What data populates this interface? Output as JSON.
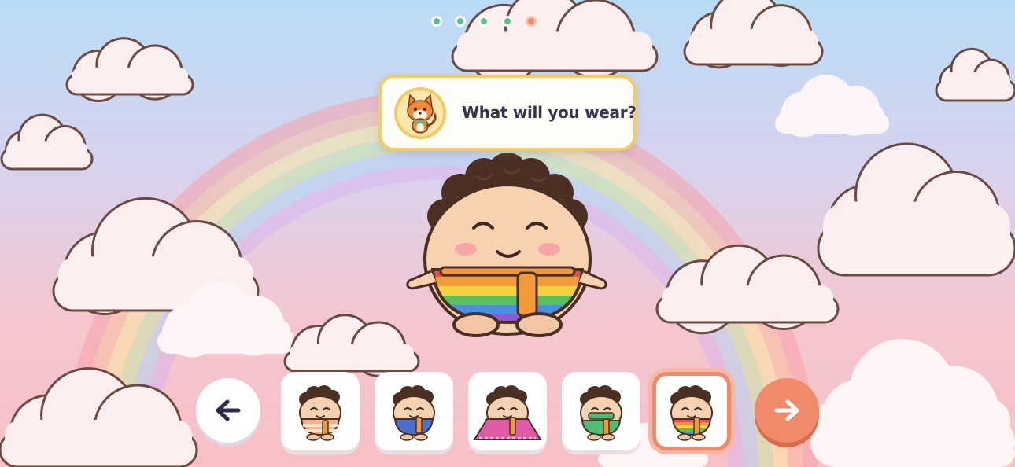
{
  "prompt": {
    "text": "What will you wear?",
    "guide_icon": "fox-guide-icon"
  },
  "progress": {
    "total_steps": 5,
    "current_step": 5,
    "colors": {
      "done": "#56c288",
      "current": "#f08a6a"
    }
  },
  "navigation": {
    "prev_icon": "arrow-left-icon",
    "next_icon": "arrow-right-icon"
  },
  "outfits": {
    "selected_index": 4,
    "items": [
      {
        "id": "orange-stripe",
        "icon": "outfit-orange-stripe-icon",
        "colors": [
          "#f6b28d",
          "#ffe2cc"
        ]
      },
      {
        "id": "blue-overalls",
        "icon": "outfit-blue-overalls-icon",
        "colors": [
          "#4a6fd0"
        ]
      },
      {
        "id": "pink-cape",
        "icon": "outfit-pink-cape-icon",
        "colors": [
          "#e05ba5"
        ]
      },
      {
        "id": "green-wrap",
        "icon": "outfit-green-wrap-icon",
        "colors": [
          "#4fbf73"
        ]
      },
      {
        "id": "rainbow-stripe",
        "icon": "outfit-rainbow-stripe-icon",
        "colors": [
          "#ee4c4c",
          "#f39a3a",
          "#f5d23c",
          "#5bbf5b",
          "#4c8fe0",
          "#8e5ad6"
        ]
      }
    ]
  },
  "palette": {
    "accent": "#f08a6a",
    "bubble_border": "#f2cc62",
    "text": "#3a3350",
    "scarf": "#f29a3a"
  }
}
